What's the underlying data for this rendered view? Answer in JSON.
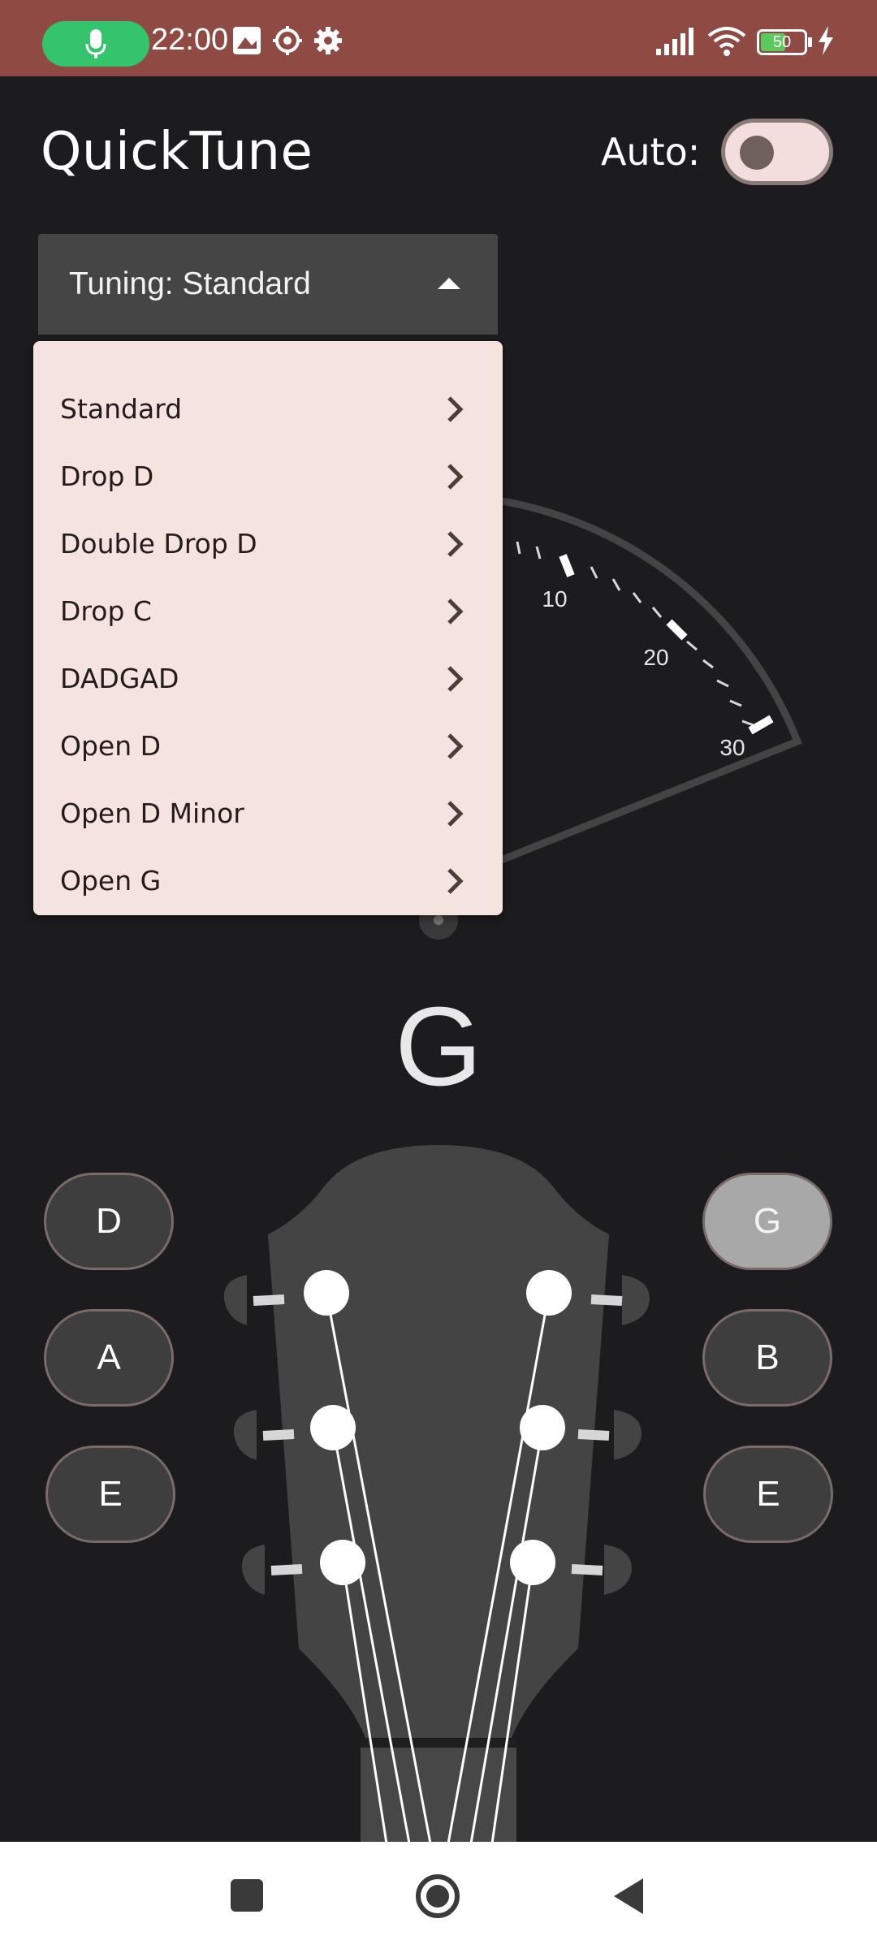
{
  "status_bar": {
    "time": "22:00",
    "battery": "50",
    "icons": [
      "mic-icon",
      "image-icon",
      "settings-outline-icon",
      "gear-icon",
      "signal-icon",
      "wifi-icon",
      "battery-icon",
      "charging-icon"
    ]
  },
  "app": {
    "title": "QuickTune",
    "auto_label": "Auto:",
    "auto_enabled": false
  },
  "tuning": {
    "label": "Tuning:  Standard",
    "options": [
      {
        "label": "Standard"
      },
      {
        "label": "Drop D"
      },
      {
        "label": "Double Drop D"
      },
      {
        "label": "Drop C"
      },
      {
        "label": "DADGAD"
      },
      {
        "label": "Open D"
      },
      {
        "label": "Open D Minor"
      },
      {
        "label": "Open G"
      }
    ]
  },
  "gauge": {
    "tick_labels": [
      "10",
      "20",
      "30"
    ]
  },
  "current_note": "G",
  "strings": {
    "left": [
      "D",
      "A",
      "E"
    ],
    "right": [
      "G",
      "B",
      "E"
    ],
    "selected": "G"
  },
  "colors": {
    "status_bar": "#8e4a43",
    "background": "#1c1c1f",
    "dropdown": "#f5e3e0",
    "mic_pill": "#34c46b"
  },
  "nav_bar": {
    "icons": [
      "recents-icon",
      "home-icon",
      "back-icon"
    ]
  }
}
